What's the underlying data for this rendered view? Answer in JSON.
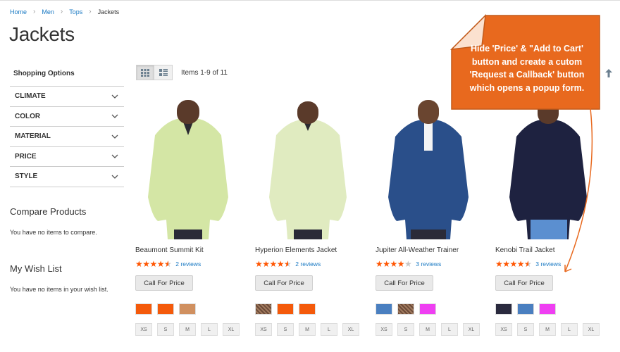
{
  "breadcrumbs": [
    {
      "label": "Home"
    },
    {
      "label": "Men"
    },
    {
      "label": "Tops"
    },
    {
      "label": "Jackets"
    }
  ],
  "page_title": "Jackets",
  "sidebar": {
    "shopping_title": "Shopping Options",
    "filters": [
      "CLIMATE",
      "COLOR",
      "MATERIAL",
      "PRICE",
      "STYLE"
    ],
    "compare_title": "Compare Products",
    "compare_text": "You have no items to compare.",
    "wishlist_title": "My Wish List",
    "wishlist_text": "You have no items in your wish list."
  },
  "toolbar": {
    "view_modes": [
      "grid-icon",
      "list-icon"
    ],
    "amount": "Items 1-9 of 11",
    "sort_icon": "arrow-up-icon"
  },
  "products": [
    {
      "name": "Beaumont Summit Kit",
      "stars": 4.5,
      "reviews": "2 reviews",
      "button": "Call For Price",
      "jacket_color": "#d4e6a5",
      "swatches": [
        "#f45a0b",
        "#f45a0b",
        "#d09060"
      ],
      "sizes": [
        "XS",
        "S",
        "M",
        "L",
        "XL"
      ]
    },
    {
      "name": "Hyperion Elements Jacket",
      "stars": 4.5,
      "reviews": "2 reviews",
      "button": "Call For Price",
      "jacket_color": "#e0ebc0",
      "swatches": [
        "pattern",
        "#f45a0b",
        "#f45a0b"
      ],
      "sizes": [
        "XS",
        "S",
        "M",
        "L",
        "XL"
      ]
    },
    {
      "name": "Jupiter All-Weather Trainer",
      "stars": 4,
      "reviews": "3 reviews",
      "button": "Call For Price",
      "jacket_color": "#2a4f8a",
      "swatches": [
        "#4a7fc0",
        "pattern",
        "#ef3ff2"
      ],
      "sizes": [
        "XS",
        "S",
        "M",
        "L",
        "XL"
      ]
    },
    {
      "name": "Kenobi Trail Jacket",
      "stars": 4.5,
      "reviews": "3 reviews",
      "button": "Call For Price",
      "jacket_color": "#1e2240",
      "swatches": [
        "#2a2a3e",
        "#4a7fc0",
        "#ef3ff2"
      ],
      "sizes": [
        "XS",
        "S",
        "M",
        "L",
        "XL"
      ]
    }
  ],
  "callout": {
    "lines": [
      "Hide 'Price' & \"Add to Cart'",
      "button and create a cutom",
      "'Request a Callback' button",
      "which opens a popup form."
    ],
    "fill_color": "#e8691e",
    "border_color": "#c25a1a"
  }
}
